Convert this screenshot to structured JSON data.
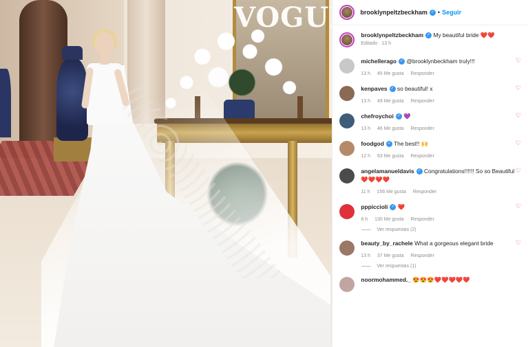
{
  "photo": {
    "watermark": "VOGUE"
  },
  "post": {
    "author": "brooklynpeltzbeckham",
    "follow_label": "Seguir",
    "caption_author": "brooklynpeltzbeckham",
    "caption_text": "My beautiful bride ❤️❤️",
    "caption_meta": "Editado · 13 h"
  },
  "comments": [
    {
      "user": "michellerago",
      "text": "@brooklynbeckham truly!!!",
      "time": "13 h",
      "likes": "45 Me gusta",
      "reply": "Responder",
      "avatar_color": "#c8c8c8"
    },
    {
      "user": "kenpaves",
      "text": "so beautiful! x",
      "time": "13 h",
      "likes": "49 Me gusta",
      "reply": "Responder",
      "avatar_color": "#8a6a55"
    },
    {
      "user": "chefroychoi",
      "text": "💜",
      "time": "13 h",
      "likes": "46 Me gusta",
      "reply": "Responder",
      "avatar_color": "#3f5d7a"
    },
    {
      "user": "foodgod",
      "text": "The best!! 🙌",
      "time": "12 h",
      "likes": "63 Me gusta",
      "reply": "Responder",
      "avatar_color": "#b58a6a"
    },
    {
      "user": "angelamanueldavis",
      "text": "Congratulations!!!!!! So so Beautiful ❤️❤️❤️❤️",
      "time": "11 h",
      "likes": "156 Me gusta",
      "reply": "Responder",
      "avatar_color": "#4b4b4b"
    },
    {
      "user": "pppiccioli",
      "text": "❤️",
      "time": "8 h",
      "likes": "130 Me gusta",
      "reply": "Responder",
      "avatar_color": "#e0303a",
      "view_replies": "Ver respuestas (2)"
    },
    {
      "user": "beauty_by_rachele",
      "text": "What a gorgeous elegant bride",
      "time": "13 h",
      "likes": "37 Me gusta",
      "reply": "Responder",
      "avatar_color": "#9a7766",
      "view_replies": "Ver respuestas (1)"
    },
    {
      "user": "noormohammed._",
      "text": "😍😍😍❤️❤️❤️❤️❤️",
      "avatar_color": "#c2a4a0"
    }
  ]
}
